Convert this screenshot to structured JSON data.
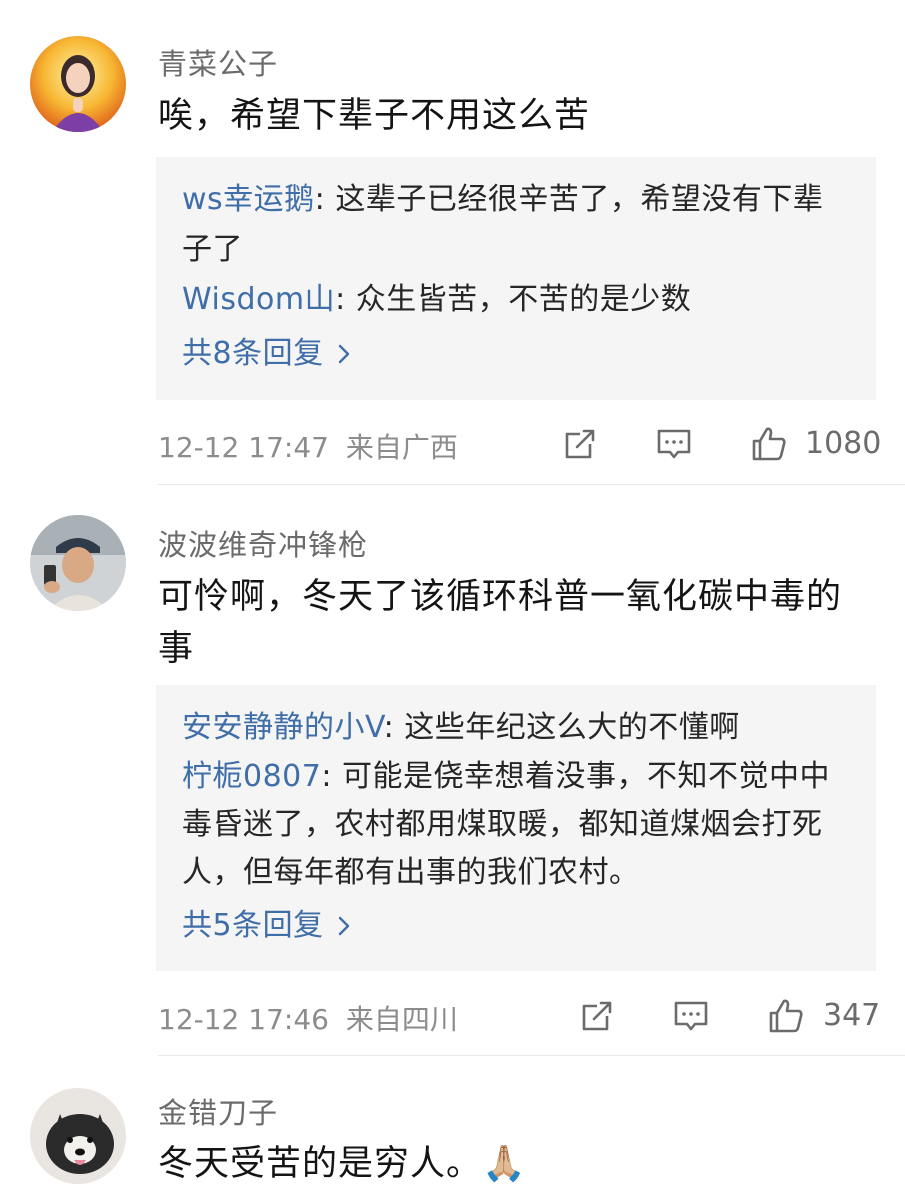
{
  "comments": [
    {
      "username": "青菜公子",
      "content": "唉，希望下辈子不用这么苦",
      "replies": [
        {
          "user": "ws幸运鹅",
          "text": ": 这辈子已经很辛苦了，希望没有下辈子了"
        },
        {
          "user": "Wisdom山",
          "text": ": 众生皆苦，不苦的是少数"
        }
      ],
      "more_replies": "共8条回复",
      "time": "12-12 17:47",
      "location": "来自广西",
      "likes": "1080"
    },
    {
      "username": "波波维奇冲锋枪",
      "content": "可怜啊，冬天了该循环科普一氧化碳中毒的事",
      "replies": [
        {
          "user": "安安静静的小V",
          "text": ": 这些年纪这么大的不懂啊"
        },
        {
          "user": "柠栀0807",
          "text": ": 可能是侥幸想着没事，不知不觉中中毒昏迷了，农村都用煤取暖，都知道煤烟会打死人，但每年都有出事的我们农村。"
        }
      ],
      "more_replies": "共5条回复",
      "time": "12-12 17:46",
      "location": "来自四川",
      "likes": "347"
    },
    {
      "username": "金错刀子",
      "content": "冬天受苦的是穷人。🙏🏼"
    }
  ],
  "icons": {
    "share": "share-icon",
    "comment": "comment-icon",
    "like": "thumbs-up-icon",
    "chevron": "chevron-right-icon"
  },
  "colors": {
    "reply_user": "#3f6ea8",
    "reply_bg": "#f5f5f5",
    "meta": "#8c8c8c"
  }
}
